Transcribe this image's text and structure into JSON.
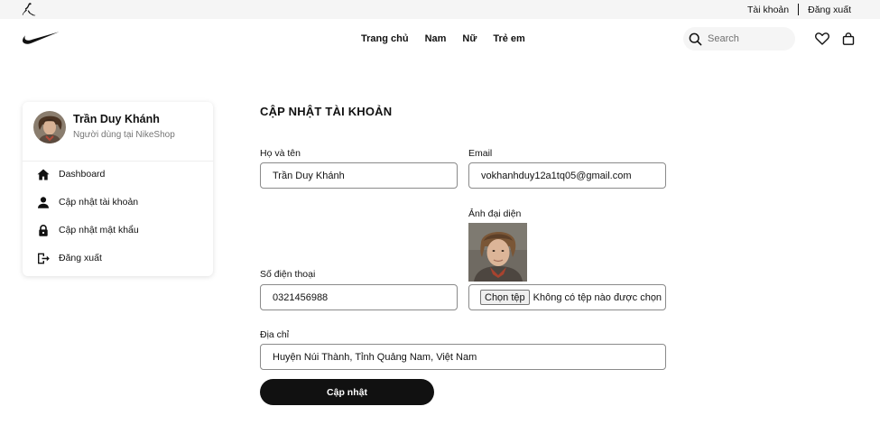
{
  "topbar": {
    "account_link": "Tài khoản",
    "logout_link": "Đăng xuất"
  },
  "nav": {
    "menu": [
      "Trang chủ",
      "Nam",
      "Nữ",
      "Trẻ em"
    ],
    "search_placeholder": "Search"
  },
  "sidebar": {
    "user_name": "Trần Duy Khánh",
    "user_role": "Người dùng tại NikeShop",
    "items": [
      {
        "label": "Dashboard",
        "icon": "home-icon"
      },
      {
        "label": "Cập nhật tài khoản",
        "icon": "user-icon"
      },
      {
        "label": "Cập nhật mật khẩu",
        "icon": "lock-icon"
      },
      {
        "label": "Đăng xuất",
        "icon": "logout-icon"
      }
    ]
  },
  "form": {
    "title": "CẬP NHẬT TÀI KHOẢN",
    "fullname_label": "Họ và tên",
    "fullname_value": "Trần Duy Khánh",
    "email_label": "Email",
    "email_value": "vokhanhduy12a1tq05@gmail.com",
    "avatar_label": "Ảnh đại diện",
    "phone_label": "Số điện thoại",
    "phone_value": "0321456988",
    "file_button": "Chọn tệp",
    "file_status": "Không có tệp nào được chọn",
    "address_label": "Địa chỉ",
    "address_value": "Huyện Núi Thành, Tỉnh Quảng Nam, Việt Nam",
    "submit_label": "Cập nhật"
  },
  "colors": {
    "accent": "#111111",
    "topbar_bg": "#f5f5f5",
    "muted_text": "#757575"
  }
}
